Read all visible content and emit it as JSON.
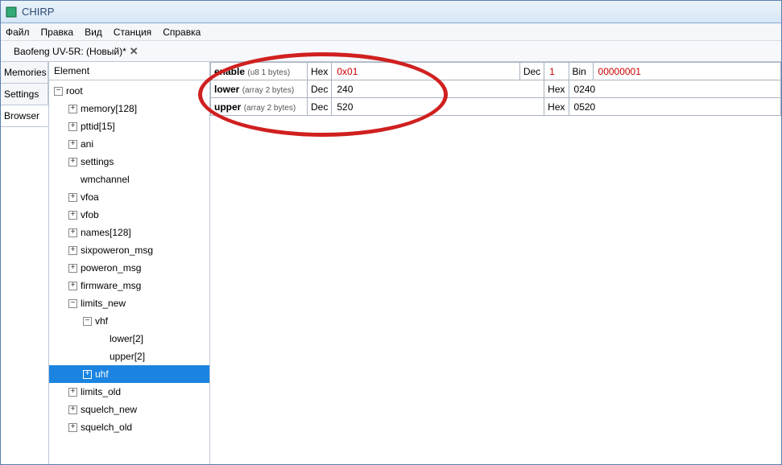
{
  "window": {
    "title": "CHIRP"
  },
  "menu": {
    "file": "Файл",
    "edit": "Правка",
    "view": "Вид",
    "station": "Станция",
    "help": "Справка"
  },
  "doc_tab": {
    "label": "Baofeng UV-5R: (Новый)*"
  },
  "side_tabs": {
    "memories": "Memories",
    "settings": "Settings",
    "browser": "Browser"
  },
  "tree": {
    "header": "Element",
    "root": "root",
    "nodes": {
      "memory": "memory[128]",
      "pttid": "pttid[15]",
      "ani": "ani",
      "settings": "settings",
      "wmchannel": "wmchannel",
      "vfoa": "vfoa",
      "vfob": "vfob",
      "names": "names[128]",
      "sixpoweron_msg": "sixpoweron_msg",
      "poweron_msg": "poweron_msg",
      "firmware_msg": "firmware_msg",
      "limits_new": "limits_new",
      "vhf": "vhf",
      "lower2": "lower[2]",
      "upper2": "upper[2]",
      "uhf": "uhf",
      "limits_old": "limits_old",
      "squelch_new": "squelch_new",
      "squelch_old": "squelch_old"
    }
  },
  "fields": {
    "enable": {
      "name": "enable",
      "type": "(u8 1 bytes)",
      "hex_lbl": "Hex",
      "hex": "0x01",
      "dec_lbl": "Dec",
      "dec": "1",
      "bin_lbl": "Bin",
      "bin": "00000001"
    },
    "lower": {
      "name": "lower",
      "type": "(array 2 bytes)",
      "dec_lbl": "Dec",
      "dec": "240",
      "hex_lbl": "Hex",
      "hex": "0240"
    },
    "upper": {
      "name": "upper",
      "type": "(array 2 bytes)",
      "dec_lbl": "Dec",
      "dec": "520",
      "hex_lbl": "Hex",
      "hex": "0520"
    }
  }
}
